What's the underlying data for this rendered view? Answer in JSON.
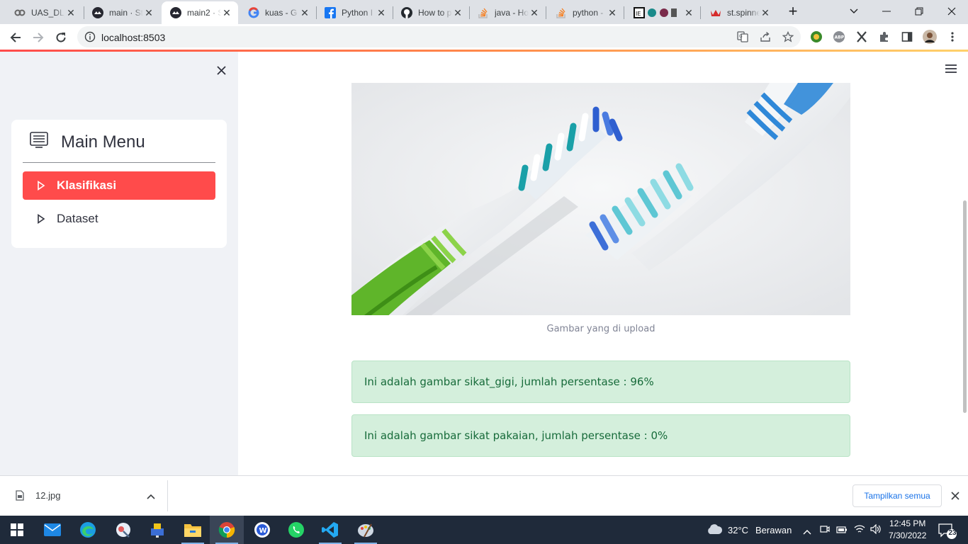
{
  "browser": {
    "tabs": [
      {
        "title": "UAS_DL_",
        "icon": "colab-icon"
      },
      {
        "title": "main · St",
        "icon": "streamlit-icon"
      },
      {
        "title": "main2 · S",
        "icon": "streamlit-icon"
      },
      {
        "title": "kuas - G",
        "icon": "google-icon"
      },
      {
        "title": "Python I",
        "icon": "facebook-icon"
      },
      {
        "title": "How to p",
        "icon": "github-icon"
      },
      {
        "title": "java - Ho",
        "icon": "stackoverflow-icon"
      },
      {
        "title": "python -",
        "icon": "stackoverflow-icon"
      },
      {
        "title": "",
        "icon": "multi-site-icons"
      },
      {
        "title": "st.spinne",
        "icon": "crown-icon"
      }
    ],
    "active_tab": 2,
    "url": "localhost:8503"
  },
  "sidebar": {
    "title": "Main Menu",
    "items": [
      {
        "label": "Klasifikasi",
        "active": true
      },
      {
        "label": "Dataset",
        "active": false
      }
    ],
    "accent": "#ff4b4b"
  },
  "main": {
    "image_caption": "Gambar yang di upload",
    "results": [
      "Ini adalah gambar sikat_gigi, jumlah persentase : 96%",
      "Ini adalah gambar sikat pakaian, jumlah persentase : 0%"
    ]
  },
  "downloads": {
    "file": "12.jpg",
    "show_all": "Tampilkan semua"
  },
  "taskbar": {
    "weather_temp": "32°C",
    "weather_desc": "Berawan",
    "time": "12:45 PM",
    "date": "7/30/2022",
    "notifications": "23"
  }
}
